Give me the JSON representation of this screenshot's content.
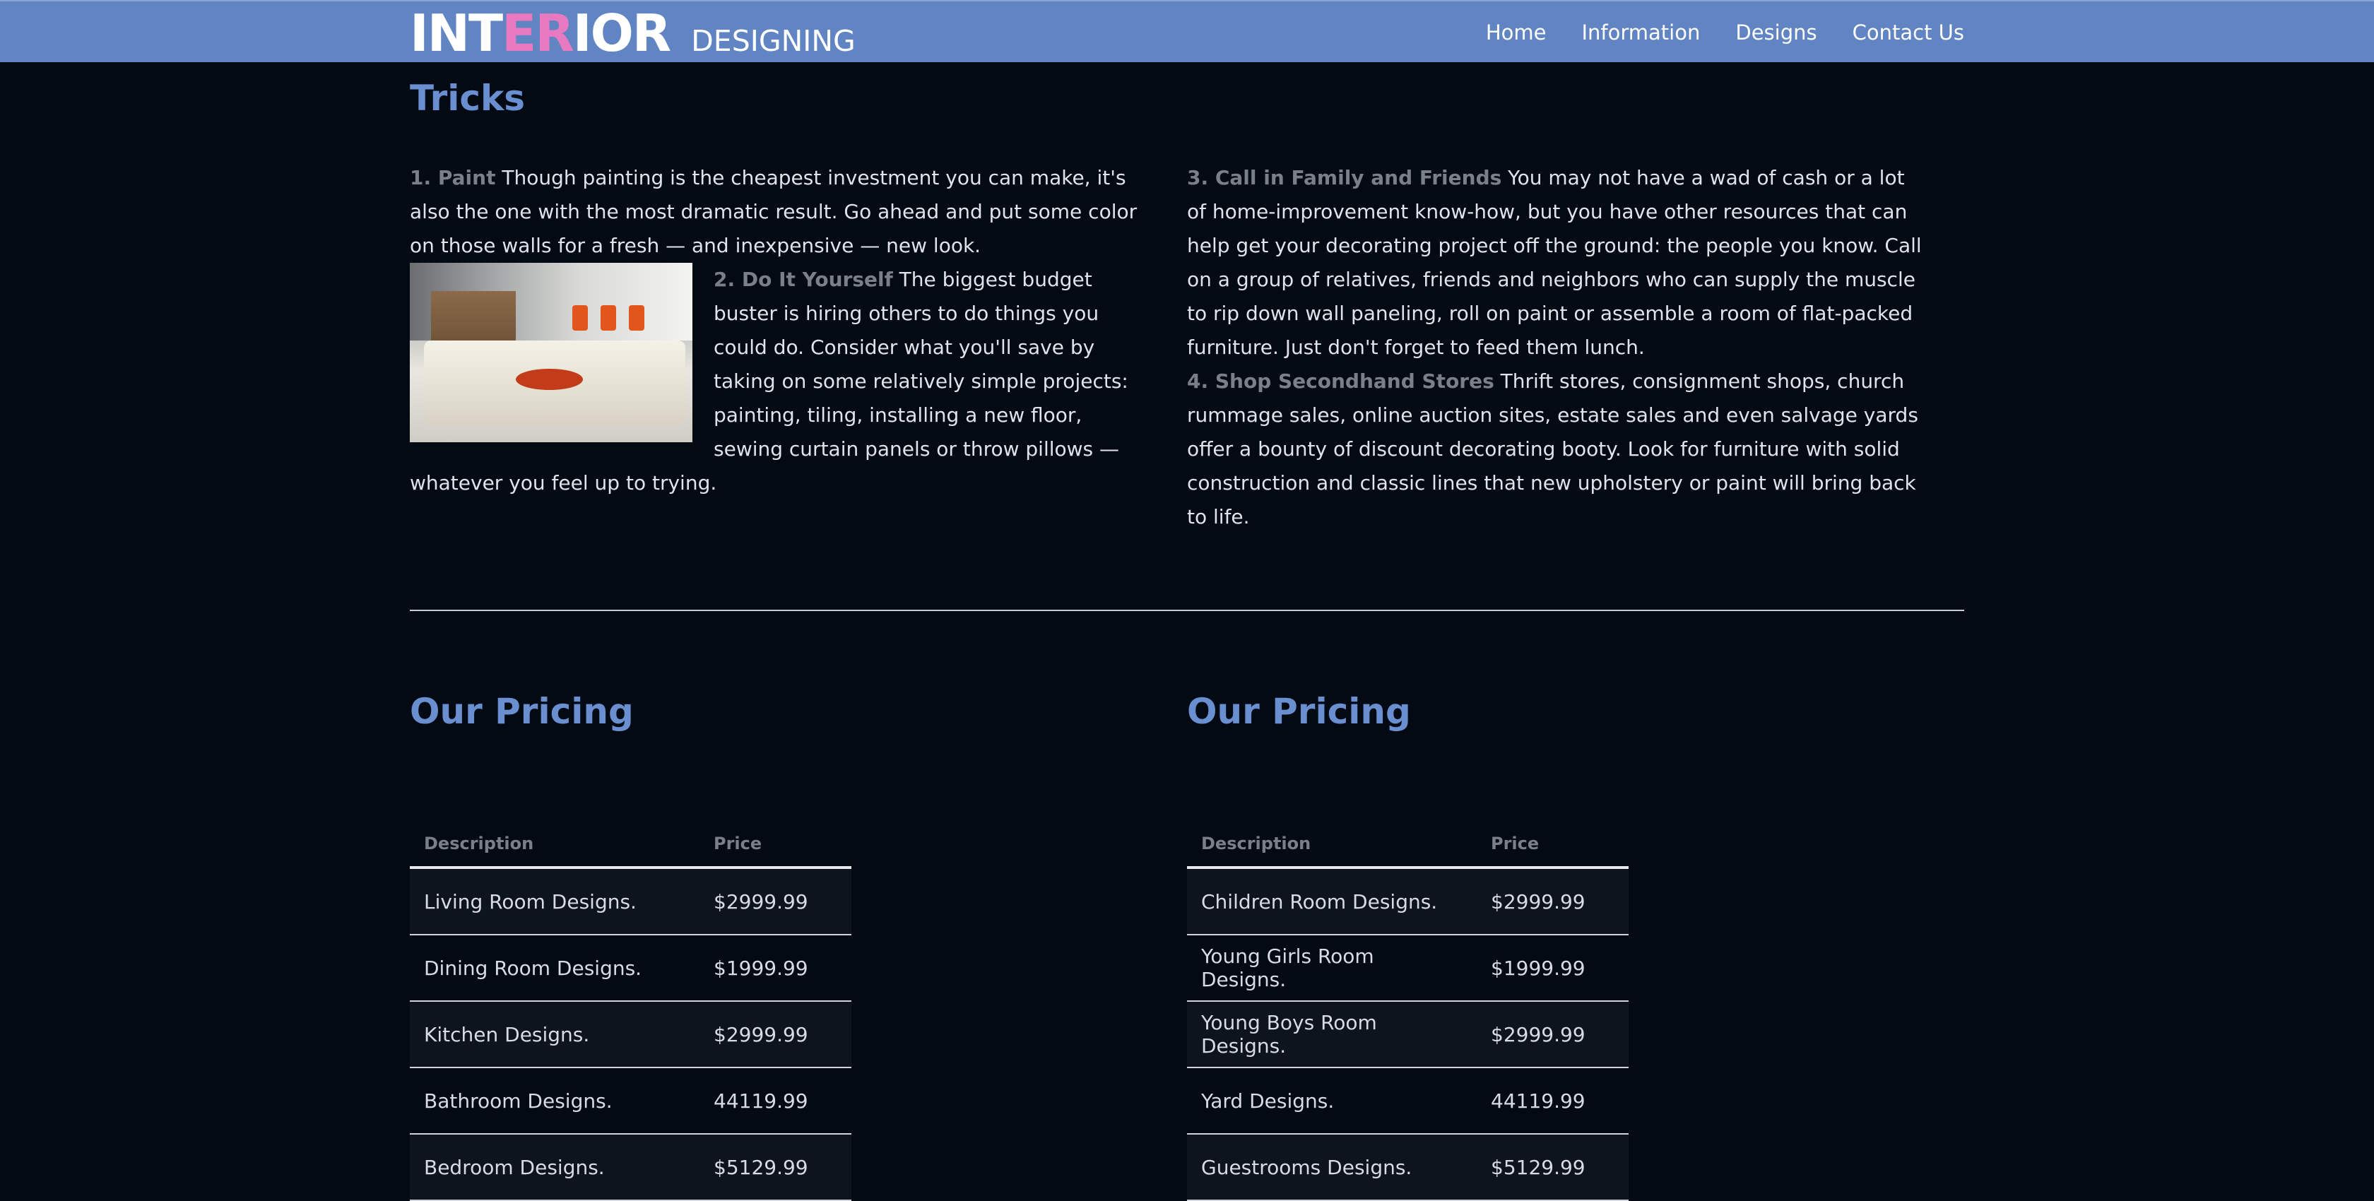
{
  "header": {
    "brand_part1": "INT",
    "brand_part2": "ER",
    "brand_part3": "IOR",
    "brand_sub": "DESIGNING",
    "nav": [
      "Home",
      "Information",
      "Designs",
      "Contact Us"
    ]
  },
  "tricks": {
    "title": "Tricks",
    "items": [
      {
        "label": "1. Paint",
        "text": " Though painting is the cheapest investment you can make, it's also the one with the most dramatic result. Go ahead and put some color on those walls for a fresh — and inexpensive — new look."
      },
      {
        "label": "2. Do It Yourself",
        "text": " The biggest budget buster is hiring others to do things you could do. Consider what you'll save by taking on some relatively simple projects: painting, tiling, installing a new floor, sewing curtain panels or throw pillows — whatever you feel up to trying."
      },
      {
        "label": "3. Call in Family and Friends",
        "text": " You may not have a wad of cash or a lot of home-improvement know-how, but you have other resources that can help get your decorating project off the ground: the people you know. Call on a group of relatives, friends and neighbors who can supply the muscle to rip down wall paneling, roll on paint or assemble a room of flat-packed furniture. Just don't forget to feed them lunch."
      },
      {
        "label": "4. Shop Secondhand Stores",
        "text": " Thrift stores, consignment shops, church rummage sales, online auction sites, estate sales and even salvage yards offer a bounty of discount decorating booty. Look for furniture with solid construction and classic lines that new upholstery or paint will bring back to life."
      }
    ]
  },
  "pricing_left": {
    "title": "Our Pricing",
    "col_desc": "Description",
    "col_price": "Price",
    "rows": [
      {
        "desc": "Living Room Designs.",
        "price": "$2999.99"
      },
      {
        "desc": "Dining Room Designs.",
        "price": "$1999.99"
      },
      {
        "desc": "Kitchen Designs.",
        "price": "$2999.99"
      },
      {
        "desc": "Bathroom Designs.",
        "price": "44119.99"
      },
      {
        "desc": "Bedroom Designs.",
        "price": "$5129.99"
      }
    ]
  },
  "pricing_right": {
    "title": "Our Pricing",
    "col_desc": "Description",
    "col_price": "Price",
    "rows": [
      {
        "desc": "Children Room Designs.",
        "price": "$2999.99"
      },
      {
        "desc": "Young Girls Room Designs.",
        "price": "$1999.99"
      },
      {
        "desc": "Young Boys Room Designs.",
        "price": "$2999.99"
      },
      {
        "desc": "Yard Designs.",
        "price": "44119.99"
      },
      {
        "desc": "Guestrooms Designs.",
        "price": "$5129.99"
      }
    ]
  },
  "colors": {
    "navbar": "#6185c2",
    "accent_pink": "#e97ac2",
    "heading_blue": "#6a8fd0",
    "background": "#040a14"
  }
}
